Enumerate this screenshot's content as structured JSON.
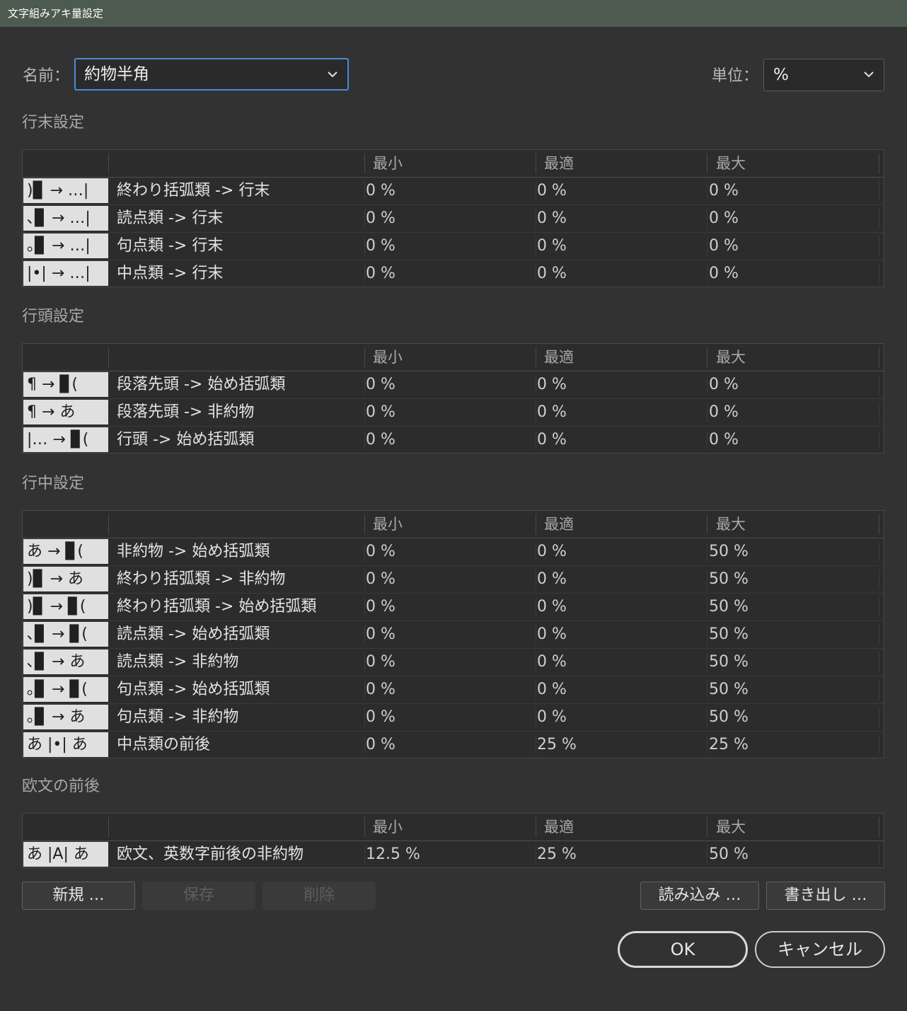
{
  "window": {
    "title": "文字組みアキ量設定"
  },
  "name_field": {
    "label": "名前：",
    "value": "約物半角"
  },
  "unit_field": {
    "label": "単位：",
    "value": "%"
  },
  "columns": {
    "min": "最小",
    "opt": "最適",
    "max": "最大"
  },
  "sections": [
    {
      "title": "行末設定",
      "rows": [
        {
          "icon": ")▊ → …|",
          "name": "終わり括弧類 -> 行末",
          "min": "0 %",
          "opt": "0 %",
          "max": "0 %"
        },
        {
          "icon": "､▊ → …|",
          "name": "読点類 -> 行末",
          "min": "0 %",
          "opt": "0 %",
          "max": "0 %"
        },
        {
          "icon": "｡▊ → …|",
          "name": "句点類 -> 行末",
          "min": "0 %",
          "opt": "0 %",
          "max": "0 %"
        },
        {
          "icon": "|•| → …|",
          "name": "中点類 -> 行末",
          "min": "0 %",
          "opt": "0 %",
          "max": "0 %"
        }
      ]
    },
    {
      "title": "行頭設定",
      "rows": [
        {
          "icon": "¶ → ▊(",
          "name": "段落先頭 -> 始め括弧類",
          "min": "0 %",
          "opt": "0 %",
          "max": "0 %"
        },
        {
          "icon": "¶ → あ",
          "name": "段落先頭 -> 非約物",
          "min": "0 %",
          "opt": "0 %",
          "max": "0 %"
        },
        {
          "icon": "|… → ▊(",
          "name": "行頭 -> 始め括弧類",
          "min": "0 %",
          "opt": "0 %",
          "max": "0 %"
        }
      ]
    },
    {
      "title": "行中設定",
      "rows": [
        {
          "icon": "あ → ▊(",
          "name": "非約物 -> 始め括弧類",
          "min": "0 %",
          "opt": "0 %",
          "max": "50 %"
        },
        {
          "icon": ")▊ → あ",
          "name": "終わり括弧類 -> 非約物",
          "min": "0 %",
          "opt": "0 %",
          "max": "50 %"
        },
        {
          "icon": ")▊ → ▊(",
          "name": "終わり括弧類 -> 始め括弧類",
          "min": "0 %",
          "opt": "0 %",
          "max": "50 %"
        },
        {
          "icon": "､▊ → ▊(",
          "name": "読点類 -> 始め括弧類",
          "min": "0 %",
          "opt": "0 %",
          "max": "50 %"
        },
        {
          "icon": "､▊ → あ",
          "name": "読点類 -> 非約物",
          "min": "0 %",
          "opt": "0 %",
          "max": "50 %"
        },
        {
          "icon": "｡▊ → ▊(",
          "name": "句点類 -> 始め括弧類",
          "min": "0 %",
          "opt": "0 %",
          "max": "50 %"
        },
        {
          "icon": "｡▊ → あ",
          "name": "句点類 -> 非約物",
          "min": "0 %",
          "opt": "0 %",
          "max": "50 %"
        },
        {
          "icon": "あ |•| あ",
          "name": "中点類の前後",
          "min": "0 %",
          "opt": "25 %",
          "max": "25 %"
        }
      ]
    },
    {
      "title": "欧文の前後",
      "rows": [
        {
          "icon": "あ |A| あ",
          "name": "欧文、英数字前後の非約物",
          "min": "12.5 %",
          "opt": "25 %",
          "max": "50 %"
        }
      ]
    }
  ],
  "buttons": {
    "new": "新規 …",
    "save": "保存",
    "delete": "削除",
    "load": "読み込み …",
    "export": "書き出し …",
    "ok": "OK",
    "cancel": "キャンセル"
  }
}
